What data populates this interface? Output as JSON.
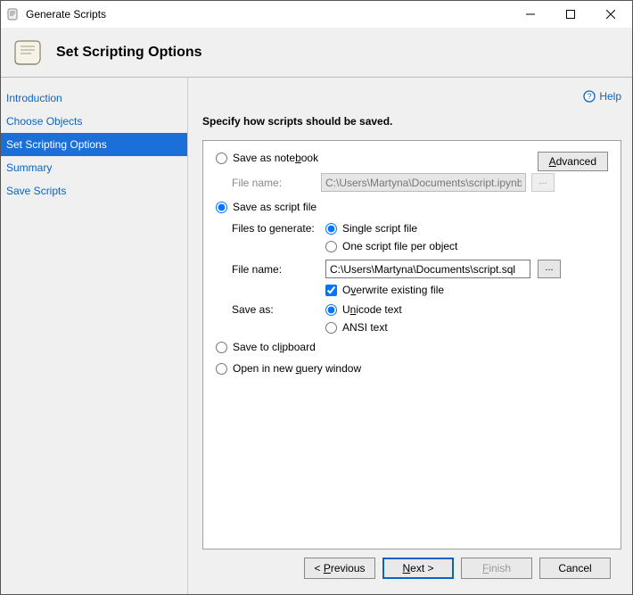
{
  "titlebar": {
    "title": "Generate Scripts"
  },
  "header": {
    "title": "Set Scripting Options"
  },
  "sidebar": {
    "items": [
      {
        "label": "Introduction",
        "active": false
      },
      {
        "label": "Choose Objects",
        "active": false
      },
      {
        "label": "Set Scripting Options",
        "active": true
      },
      {
        "label": "Summary",
        "active": false
      },
      {
        "label": "Save Scripts",
        "active": false
      }
    ]
  },
  "help": {
    "label": "Help"
  },
  "instruction": "Specify how scripts should be saved.",
  "advanced": {
    "label_pre": "A",
    "label_post": "dvanced"
  },
  "options": {
    "save_notebook": {
      "label_pre": "Save as note",
      "label_accel": "b",
      "label_post": "ook",
      "filename_label": "File name:",
      "filename_value": "C:\\Users\\Martyna\\Documents\\script.ipynb",
      "browse": "..."
    },
    "save_scriptfile": {
      "label": "Save as script file",
      "files_to_generate": "Files to generate:",
      "single": "Single script file",
      "perobject": "One script file per object",
      "filename_label": "File name:",
      "filename_value": "C:\\Users\\Martyna\\Documents\\script.sql",
      "browse": "...",
      "overwrite_pre": "O",
      "overwrite_accel": "v",
      "overwrite_post": "erwrite existing file",
      "save_as": "Save as:",
      "unicode_pre": "U",
      "unicode_accel": "n",
      "unicode_post": "icode text",
      "ansi": "ANSI text"
    },
    "clipboard": {
      "pre": "Save to cl",
      "accel": "i",
      "post": "pboard"
    },
    "newquery": {
      "pre": "Open in new ",
      "accel": "q",
      "post": "uery window"
    }
  },
  "footer": {
    "previous_pre": "< ",
    "previous_accel": "P",
    "previous_post": "revious",
    "next_pre": "",
    "next_accel": "N",
    "next_post": "ext >",
    "finish_pre": "",
    "finish_accel": "F",
    "finish_post": "inish",
    "cancel": "Cancel"
  }
}
